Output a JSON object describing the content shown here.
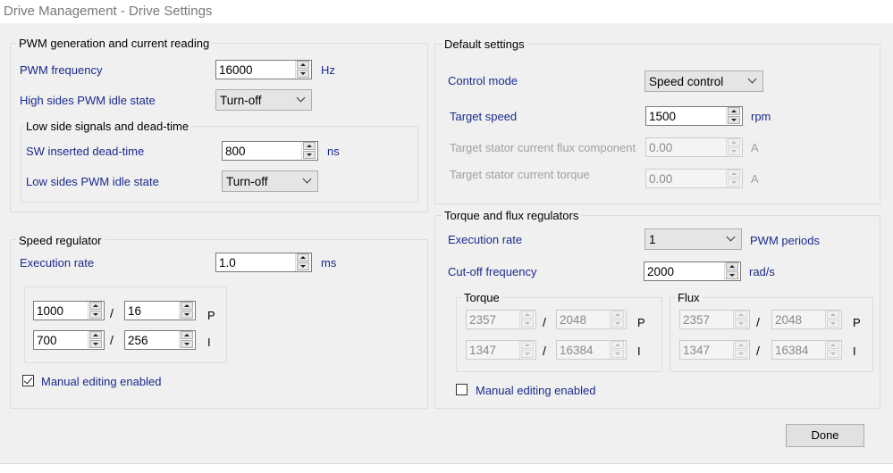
{
  "window": {
    "title": "Drive Management - Drive Settings"
  },
  "pwm": {
    "legend": "PWM generation and current reading",
    "freq_label": "PWM frequency",
    "freq_value": "16000",
    "freq_unit": "Hz",
    "high_idle_label": "High sides PWM idle state",
    "high_idle_value": "Turn-off",
    "low": {
      "legend": "Low side signals and dead-time",
      "dead_label": "SW inserted dead-time",
      "dead_value": "800",
      "dead_unit": "ns",
      "idle_label": "Low sides PWM idle state",
      "idle_value": "Turn-off"
    }
  },
  "speed": {
    "legend": "Speed regulator",
    "exec_label": "Execution rate",
    "exec_value": "1.0",
    "exec_unit": "ms",
    "p_num": "1000",
    "p_den": "16",
    "p_label": "P",
    "i_num": "700",
    "i_den": "256",
    "i_label": "I",
    "slash": "/",
    "manual_label": "Manual editing enabled",
    "manual_checked": true
  },
  "defaults": {
    "legend": "Default settings",
    "mode_label": "Control mode",
    "mode_value": "Speed control",
    "target_speed_label": "Target speed",
    "target_speed_value": "1500",
    "target_speed_unit": "rpm",
    "flux_label": "Target stator current flux component",
    "flux_value": "0.00",
    "flux_unit": "A",
    "torque_label": "Target stator current torque",
    "torque_value": "0.00",
    "torque_unit": "A"
  },
  "tf": {
    "legend": "Torque and flux regulators",
    "exec_label": "Execution rate",
    "exec_value": "1",
    "exec_unit": "PWM periods",
    "cutoff_label": "Cut-off frequency",
    "cutoff_value": "2000",
    "cutoff_unit": "rad/s",
    "torque": {
      "legend": "Torque",
      "p_num": "2357",
      "p_den": "2048",
      "i_num": "1347",
      "i_den": "16384"
    },
    "flux": {
      "legend": "Flux",
      "p_num": "2357",
      "p_den": "2048",
      "i_num": "1347",
      "i_den": "16384"
    },
    "p_label": "P",
    "i_label": "I",
    "slash": "/",
    "manual_label": "Manual editing enabled",
    "manual_checked": false
  },
  "done_label": "Done",
  "colors": {
    "label_blue": "#1a2a8c",
    "disabled_text": "#a0a0a0",
    "background": "#f0f0f0"
  }
}
